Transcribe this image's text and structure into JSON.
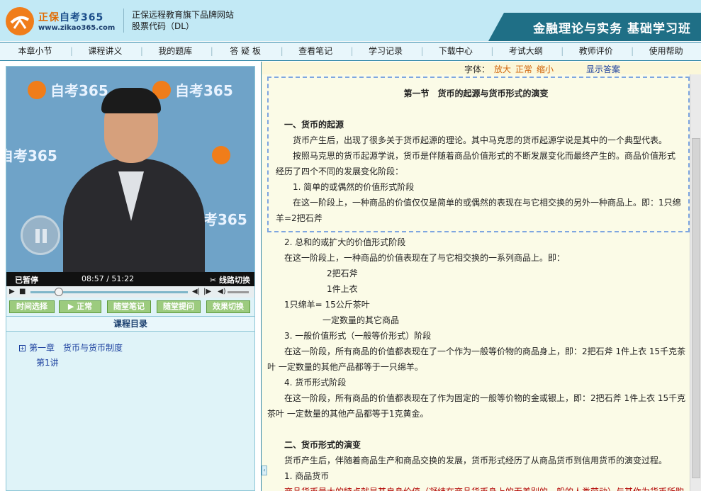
{
  "header": {
    "brand_main": "正保",
    "brand_sub": "自考365",
    "brand_url": "www.zikao365.com",
    "tagline": "正保远程教育旗下品牌网站",
    "stock": "股票代码（DL）",
    "course": "金融理论与实务 基础学习班"
  },
  "nav": [
    "本章小节",
    "课程讲义",
    "我的题库",
    "答 疑 板",
    "查看笔记",
    "学习记录",
    "下载中心",
    "考试大纲",
    "教师评价",
    "使用帮助"
  ],
  "video": {
    "watermark": "自考365",
    "watermark_url": "zikao365.com",
    "status": "已暂停",
    "time": "08:57 / 51:22",
    "switch": "线路切换",
    "progress": 0.178,
    "buttons": [
      "时间选择",
      "正常",
      "随堂笔记",
      "随堂提问",
      "效果切换"
    ]
  },
  "toc": {
    "heading": "课程目录",
    "chapter": "第一章　货币与货币制度",
    "lesson": "第1讲"
  },
  "toolbar": {
    "font_label": "字体：",
    "big": "放大",
    "normal": "正常",
    "small": "缩小",
    "answer": "显示答案"
  },
  "content": {
    "title": "第一节　货币的起源与货币形式的演变",
    "lines": [
      "一、货币的起源",
      "货币产生后，出现了很多关于货币起源的理论。其中马克思的货币起源学说是其中的一个典型代表。",
      "按照马克思的货币起源学说，货币是伴随着商品价值形式的不断发展变化而最终产生的。商品价值形式",
      "经历了四个不同的发展变化阶段：",
      "1. 简单的或偶然的价值形式阶段",
      "在这一阶段上，一种商品的价值仅仅是简单的或偶然的表现在与它相交换的另外一种商品上。即：1只绵",
      "羊=2把石斧",
      "2. 总和的或扩大的价值形式阶段",
      "在这一阶段上，一种商品的价值表现在了与它相交换的一系列商品上。即：",
      "2把石斧",
      "1件上衣",
      "1只绵羊= 15公斤茶叶",
      "一定数量的其它商品",
      "3. 一般价值形式（一般等价形式）阶段",
      "在这一阶段，所有商品的价值都表现在了一个作为一般等价物的商品身上，即：2把石斧 1件上衣 15千克茶",
      "叶 一定数量的其他产品都等于一只绵羊。",
      "4. 货币形式阶段",
      "在这一阶段，所有商品的价值都表现在了作为固定的一般等价物的金或银上，即：2把石斧 1件上衣 15千克",
      "茶叶 一定数量的其他产品都等于1克黄金。",
      "二、货币形式的演变",
      "货币产生后，伴随着商品生产和商品交换的发展，货币形式经历了从商品货币到信用货币的演变过程。",
      "1. 商品货币",
      "商品货币最大的特点就是其自身价值（凝结在商品货币身上的无差别的一般的人类劳动）与其作为货币所购"
    ]
  }
}
